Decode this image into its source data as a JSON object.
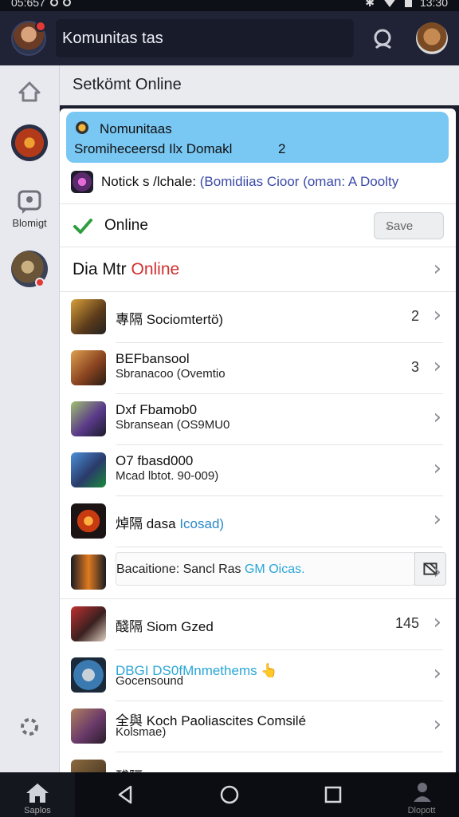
{
  "status_bar": {
    "left_text": "05:657",
    "time": "13:30"
  },
  "app_bar": {
    "title": "Komunitas tas"
  },
  "rail": {
    "chat_label": "Blomigt"
  },
  "sub_header": {
    "title": "Setkömt Online"
  },
  "banner": {
    "line1": "Nomunitaas",
    "line2": "Sromiheceersd  Ilx  Domakl",
    "line2_suffix": "2"
  },
  "notice": {
    "prefix": "Notick s /lchale: ",
    "link": "(Bomidiias Cioor (oman: A Doolty"
  },
  "online": {
    "label": "Online",
    "button": "Save"
  },
  "section": {
    "title_a": "Dia Mtr ",
    "title_b": "Online"
  },
  "list": [
    {
      "line1": "專隔 Sociomtertö)",
      "line2": "",
      "count": "2"
    },
    {
      "line1": "BEFbansool",
      "line2": "Sbranacoo (Ovemtio",
      "count": "3"
    },
    {
      "line1": "Dxf Fbamob0",
      "line2": "Sbransean (OS9MU0",
      "count": ""
    },
    {
      "line1": "O7 fbasd000",
      "line2": "Mcad lbtot. 90-009)",
      "count": ""
    },
    {
      "line1": "焯隔 dasa ",
      "line1_blue": "Icosad)",
      "line2": "",
      "count": ""
    },
    {
      "line1": "Bacaitione:  Sancl Ras ",
      "line1_blue": "GM Oicas.",
      "line2": "",
      "count": ""
    },
    {
      "line1": "醆隔 Siom Gzed",
      "line2": "",
      "count": "145"
    },
    {
      "line1": "DBGI DS0fMnmethems",
      "line2": "Gocensound",
      "count": ""
    },
    {
      "line1": "全與 Koch Paolias",
      "line1_rest": "cites Comsilé",
      "line2": "Kolsmae)",
      "count": ""
    }
  ],
  "partial_row": "醆隔 ...  ...",
  "nav": {
    "home_label": "Saplos",
    "profile_label": "Dlopott"
  },
  "colors": {
    "appbar": "#1f2335",
    "banner": "#79c7f3",
    "accent_red": "#d23030",
    "check_green": "#2e9e3e"
  }
}
